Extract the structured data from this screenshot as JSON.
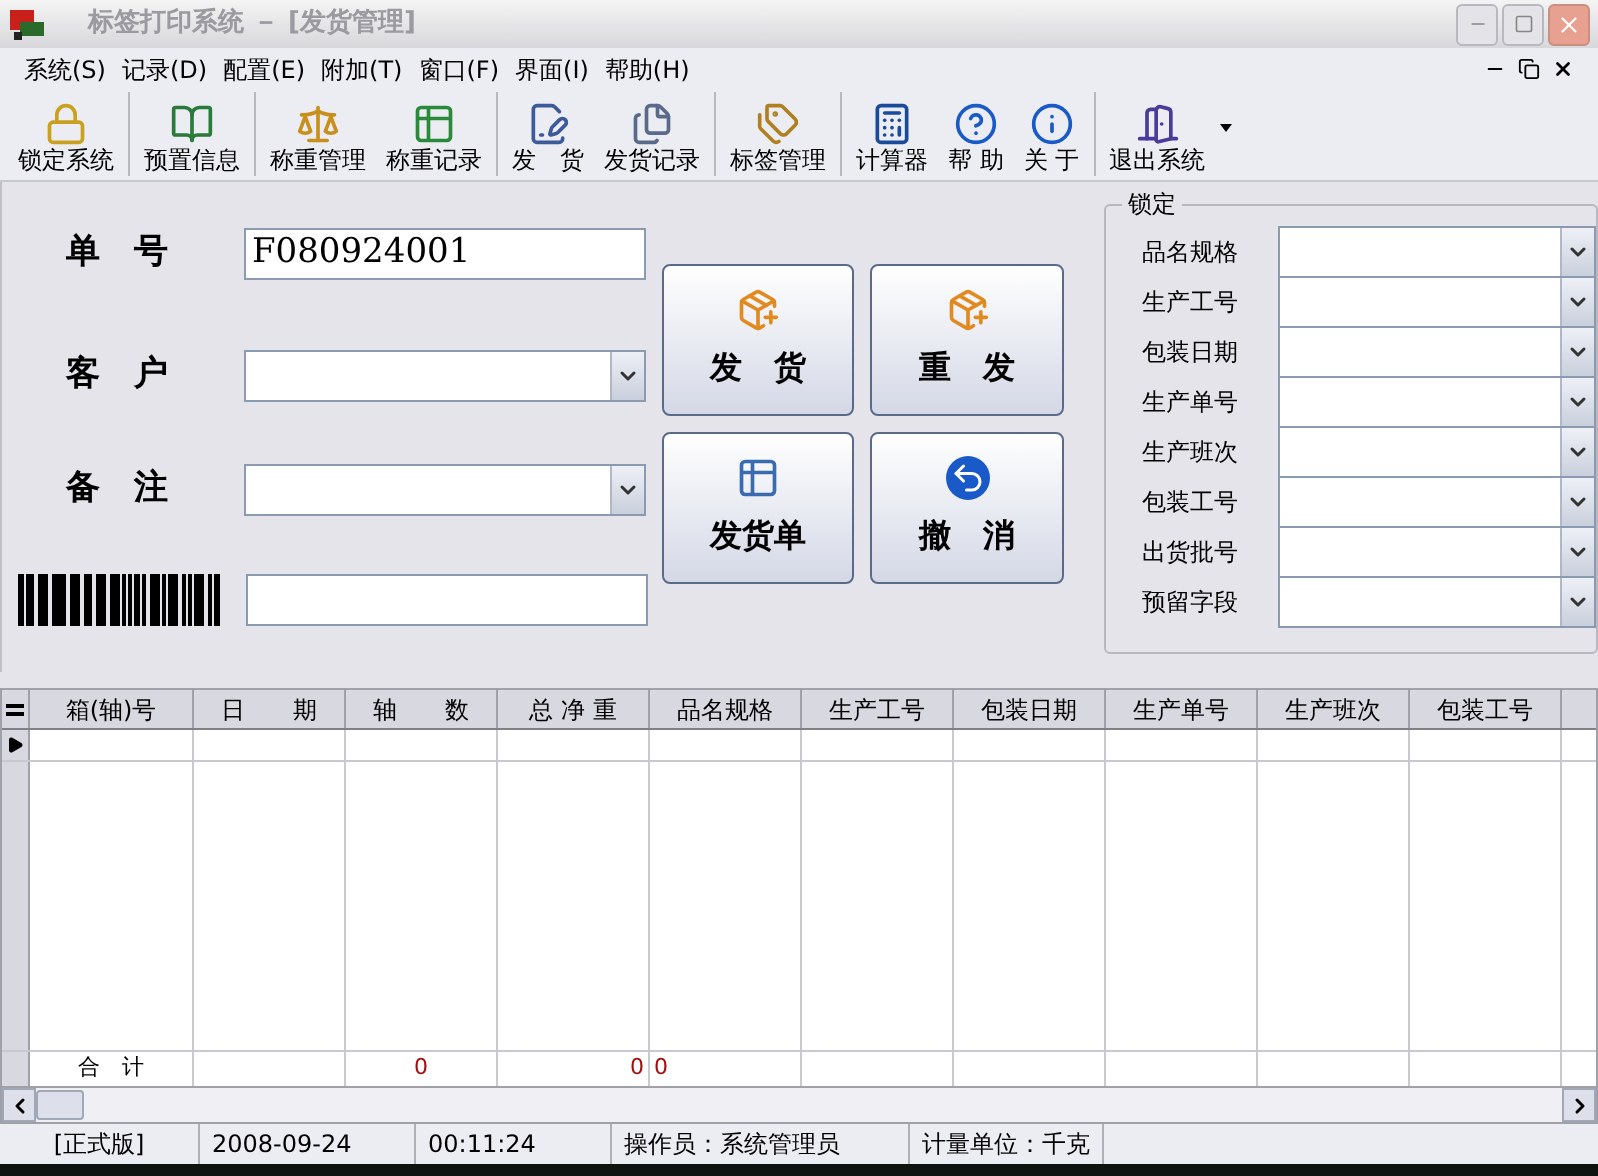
{
  "window": {
    "title": "标签打印系统 － [发货管理]"
  },
  "menu": [
    "系统(S)",
    "记录(D)",
    "配置(E)",
    "附加(T)",
    "窗口(F)",
    "界面(I)",
    "帮助(H)"
  ],
  "toolbar": [
    [
      "锁定系统"
    ],
    [
      "预置信息"
    ],
    [
      "称重管理",
      "称重记录"
    ],
    [
      "发　货",
      "发货记录"
    ],
    [
      "标签管理"
    ],
    [
      "计算器",
      "帮 助",
      "关 于"
    ],
    [
      "退出系统"
    ]
  ],
  "form": {
    "fields": [
      {
        "label": "单　号",
        "kind": "text",
        "value": "F080924001"
      },
      {
        "label": "客　户",
        "kind": "combo"
      },
      {
        "label": "备　注",
        "kind": "combo"
      }
    ],
    "buttons": [
      "发　货",
      "重　发",
      "发货单",
      "撤　消"
    ]
  },
  "lock_group": {
    "title": "锁定",
    "fields": [
      "品名规格",
      "生产工号",
      "包装日期",
      "生产单号",
      "生产班次",
      "包装工号",
      "出货批号",
      "预留字段"
    ]
  },
  "table": {
    "columns": [
      "箱(轴)号",
      "日　　期",
      "轴　　数",
      "总 净 重",
      "品名规格",
      "生产工号",
      "包装日期",
      "生产单号",
      "生产班次",
      "包装工号"
    ],
    "rows": [
      {
        "current": true
      }
    ],
    "totals": {
      "label": "合　计",
      "axle_count": "0",
      "total_net_weight": "0",
      "product_spec": "0"
    }
  },
  "status_bar": [
    "[正式版]",
    "2008-09-24",
    "00:11:24",
    "操作员：系统管理员",
    "计量单位：千克"
  ]
}
